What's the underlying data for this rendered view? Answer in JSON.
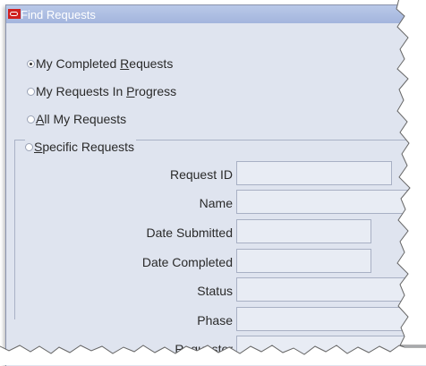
{
  "window": {
    "title": "Find Requests"
  },
  "options": [
    {
      "before": "My Completed ",
      "key": "R",
      "after": "equests",
      "checked": true
    },
    {
      "before": "My Requests In ",
      "key": "P",
      "after": "rogress",
      "checked": false
    },
    {
      "before": "",
      "key": "A",
      "after": "ll My Requests",
      "checked": false
    }
  ],
  "specific": {
    "before": "",
    "key": "S",
    "after": "pecific Requests",
    "checked": false
  },
  "fields": [
    {
      "label": "Request ID"
    },
    {
      "label": "Name"
    },
    {
      "label": "Date Submitted"
    },
    {
      "label": "Date Completed"
    },
    {
      "label": "Status"
    },
    {
      "label": "Phase"
    },
    {
      "label": "Requestor"
    }
  ]
}
